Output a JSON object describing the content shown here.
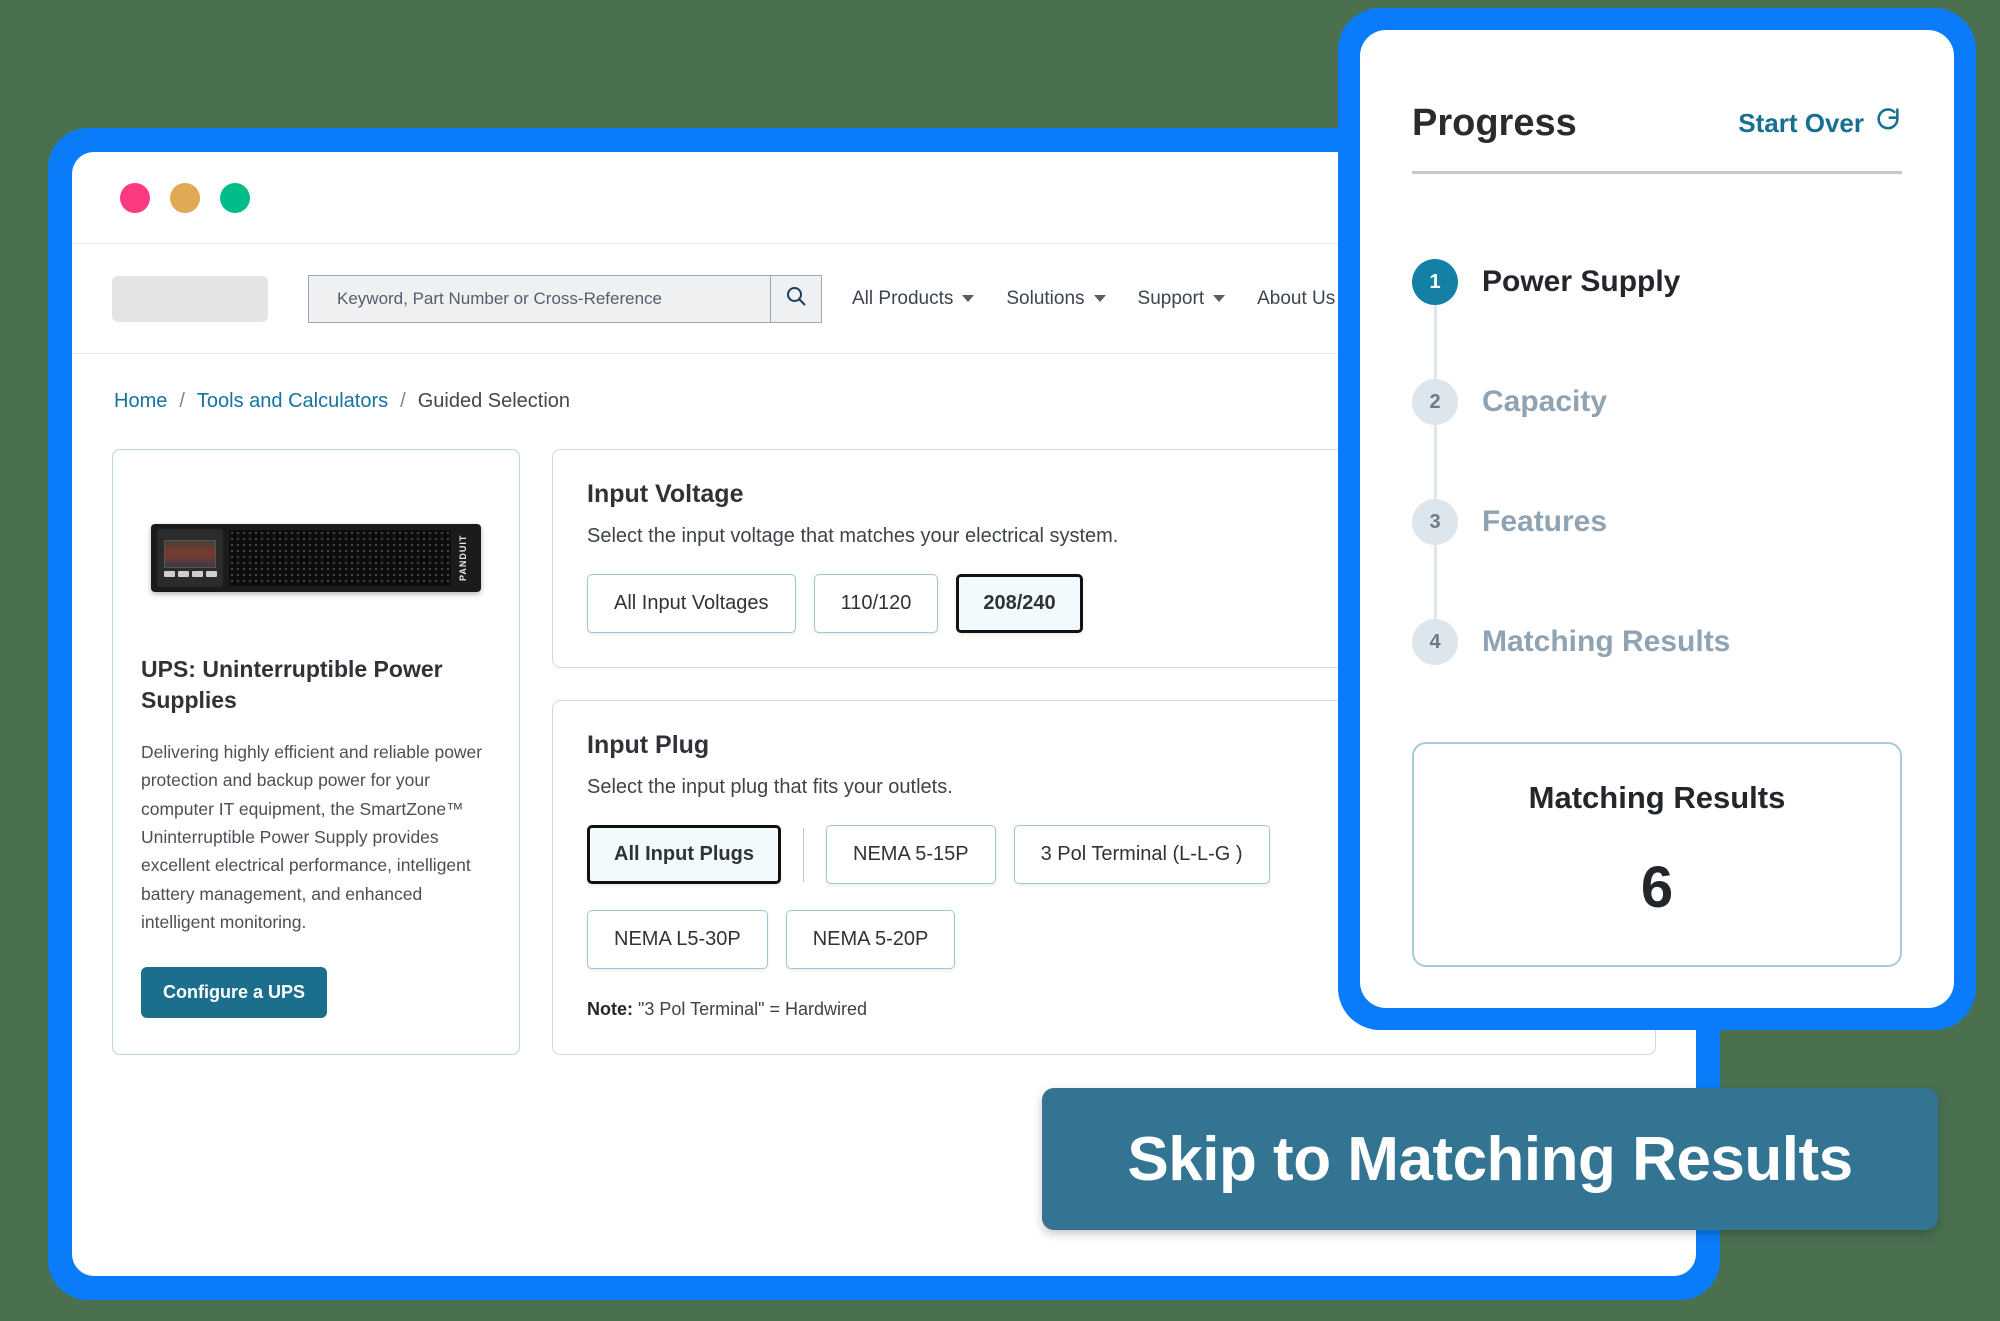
{
  "window": {
    "dots": [
      "close-dot",
      "minimize-dot",
      "maximize-dot"
    ]
  },
  "header": {
    "search": {
      "placeholder": "Keyword, Part Number or Cross-Reference",
      "value": "",
      "icon": "search-icon"
    },
    "nav": [
      {
        "label": "All Products"
      },
      {
        "label": "Solutions"
      },
      {
        "label": "Support"
      },
      {
        "label": "About Us"
      }
    ]
  },
  "breadcrumb": {
    "items": [
      {
        "label": "Home",
        "link": true
      },
      {
        "label": "Tools and Calculators",
        "link": true
      },
      {
        "label": "Guided Selection",
        "link": false
      }
    ],
    "separator": "/"
  },
  "product": {
    "image_alt": "rack-mount-ups",
    "brand": "PANDUIT",
    "title": "UPS: Uninterruptible Power Supplies",
    "description": "Delivering highly efficient and reliable power protection and backup power for your computer IT equipment, the SmartZone™ Uninterruptible Power Supply provides excellent electrical performance, intelligent battery management, and enhanced intelligent monitoring.",
    "cta_label": "Configure a UPS"
  },
  "panels": [
    {
      "title": "Input Voltage",
      "subtitle": "Select the input voltage that matches your electrical system.",
      "options": [
        {
          "label": "All Input Voltages",
          "selected": false
        },
        {
          "label": "110/120",
          "selected": false
        },
        {
          "label": "208/240",
          "selected": true
        }
      ],
      "note": ""
    },
    {
      "title": "Input Plug",
      "subtitle": "Select the input plug that fits your outlets.",
      "options": [
        {
          "label": "All Input Plugs",
          "selected": true
        },
        {
          "label": "NEMA 5-15P",
          "selected": false
        },
        {
          "label": "3 Pol Terminal (L-L-G )",
          "selected": false
        },
        {
          "label": "NEMA L5-30P",
          "selected": false
        },
        {
          "label": "NEMA 5-20P",
          "selected": false
        }
      ],
      "note_prefix": "Note:",
      "note_text": " \"3 Pol Terminal\" = Hardwired"
    }
  ],
  "progress": {
    "title": "Progress",
    "start_over_label": "Start Over",
    "start_over_icon": "refresh-icon",
    "steps": [
      {
        "number": "1",
        "label": "Power Supply",
        "state": "active"
      },
      {
        "number": "2",
        "label": "Capacity",
        "state": "inactive"
      },
      {
        "number": "3",
        "label": "Features",
        "state": "inactive"
      },
      {
        "number": "4",
        "label": "Matching Results",
        "state": "inactive"
      }
    ],
    "results": {
      "title": "Matching Results",
      "count": "6"
    }
  },
  "skip_banner": {
    "label": "Skip to Matching Results"
  },
  "colors": {
    "background": "#4a7050",
    "frame_blue": "#0a7cfa",
    "accent_teal": "#1b6e8c",
    "banner_teal": "#337492",
    "link_blue": "#1572a1",
    "step_active": "#1580a6",
    "step_inactive_text": "#8fa3b2",
    "dot_red": "#fd3982",
    "dot_yellow": "#e0a954",
    "dot_green": "#00bd8a"
  }
}
